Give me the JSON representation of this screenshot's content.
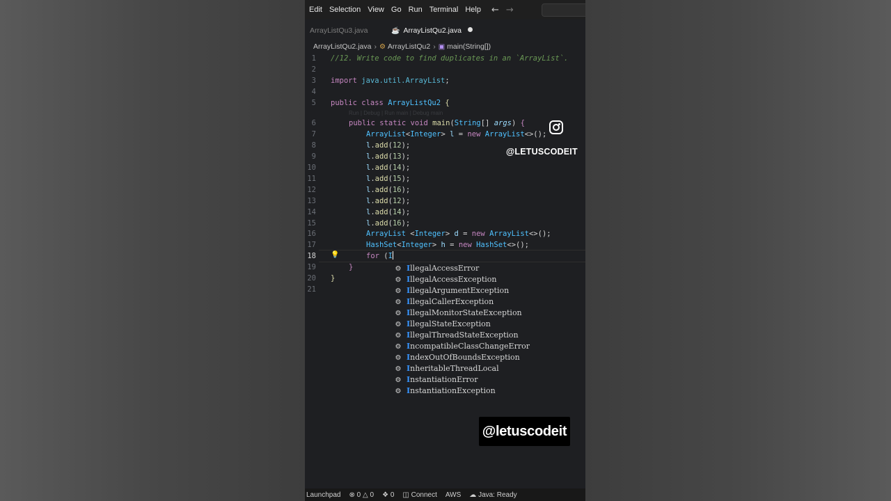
{
  "menu": {
    "items": [
      "Edit",
      "Selection",
      "View",
      "Go",
      "Run",
      "Terminal",
      "Help"
    ]
  },
  "tabs": [
    {
      "label": "ArrayListQu3.java",
      "active": false
    },
    {
      "label": "ArrayListQu2.java",
      "active": true,
      "modified": true
    }
  ],
  "breadcrumb": {
    "file": "ArrayListQu2.java",
    "class": "ArrayListQu2",
    "method": "main(String[])"
  },
  "editor": {
    "current_line": 18,
    "line_numbers": [
      "1",
      "2",
      "3",
      "4",
      "5",
      "6",
      "7",
      "8",
      "9",
      "10",
      "11",
      "12",
      "13",
      "14",
      "15",
      "16",
      "17",
      "18",
      "19",
      "20",
      "21"
    ],
    "comment": "//12. Write code to find duplicates in an `ArrayList`.",
    "codelens": "Run | Debug | Run main | Debug main",
    "tokens": {
      "import": "import",
      "java_util_arraylist": "java.util.ArrayList",
      "public": "public",
      "class": "class",
      "classname": "ArrayListQu2",
      "static": "static",
      "void": "void",
      "main": "main",
      "String": "String",
      "args": "args",
      "ArrayList": "ArrayList",
      "Integer": "Integer",
      "l": "l",
      "new": "new",
      "add": "add",
      "d": "d",
      "HashSet": "HashSet",
      "h": "h",
      "for": "for",
      "I": "I"
    },
    "adds": [
      "12",
      "13",
      "14",
      "15",
      "16",
      "12",
      "14",
      "16"
    ]
  },
  "suggestions": {
    "prefix": "I",
    "items": [
      {
        "rest": "llegalAccessError"
      },
      {
        "rest": "llegalAccessException"
      },
      {
        "rest": "llegalArgumentException"
      },
      {
        "rest": "llegalCallerException"
      },
      {
        "rest": "llegalMonitorStateException"
      },
      {
        "rest": "llegalStateException"
      },
      {
        "rest": "llegalThreadStateException"
      },
      {
        "rest": "ncompatibleClassChangeError"
      },
      {
        "rest": "ndexOutOfBoundsException"
      },
      {
        "rest": "nheritableThreadLocal"
      },
      {
        "rest": "nstantiationError"
      },
      {
        "rest": "nstantiationException"
      }
    ]
  },
  "overlay": {
    "instagram_handle": "@LETUSCODEIT",
    "watermark": "@letuscodeit"
  },
  "statusbar": {
    "launchpad": "Launchpad",
    "errors": "0",
    "warnings": "0",
    "ports": "0",
    "connect": "Connect",
    "aws": "AWS",
    "java": "Java: Ready"
  }
}
